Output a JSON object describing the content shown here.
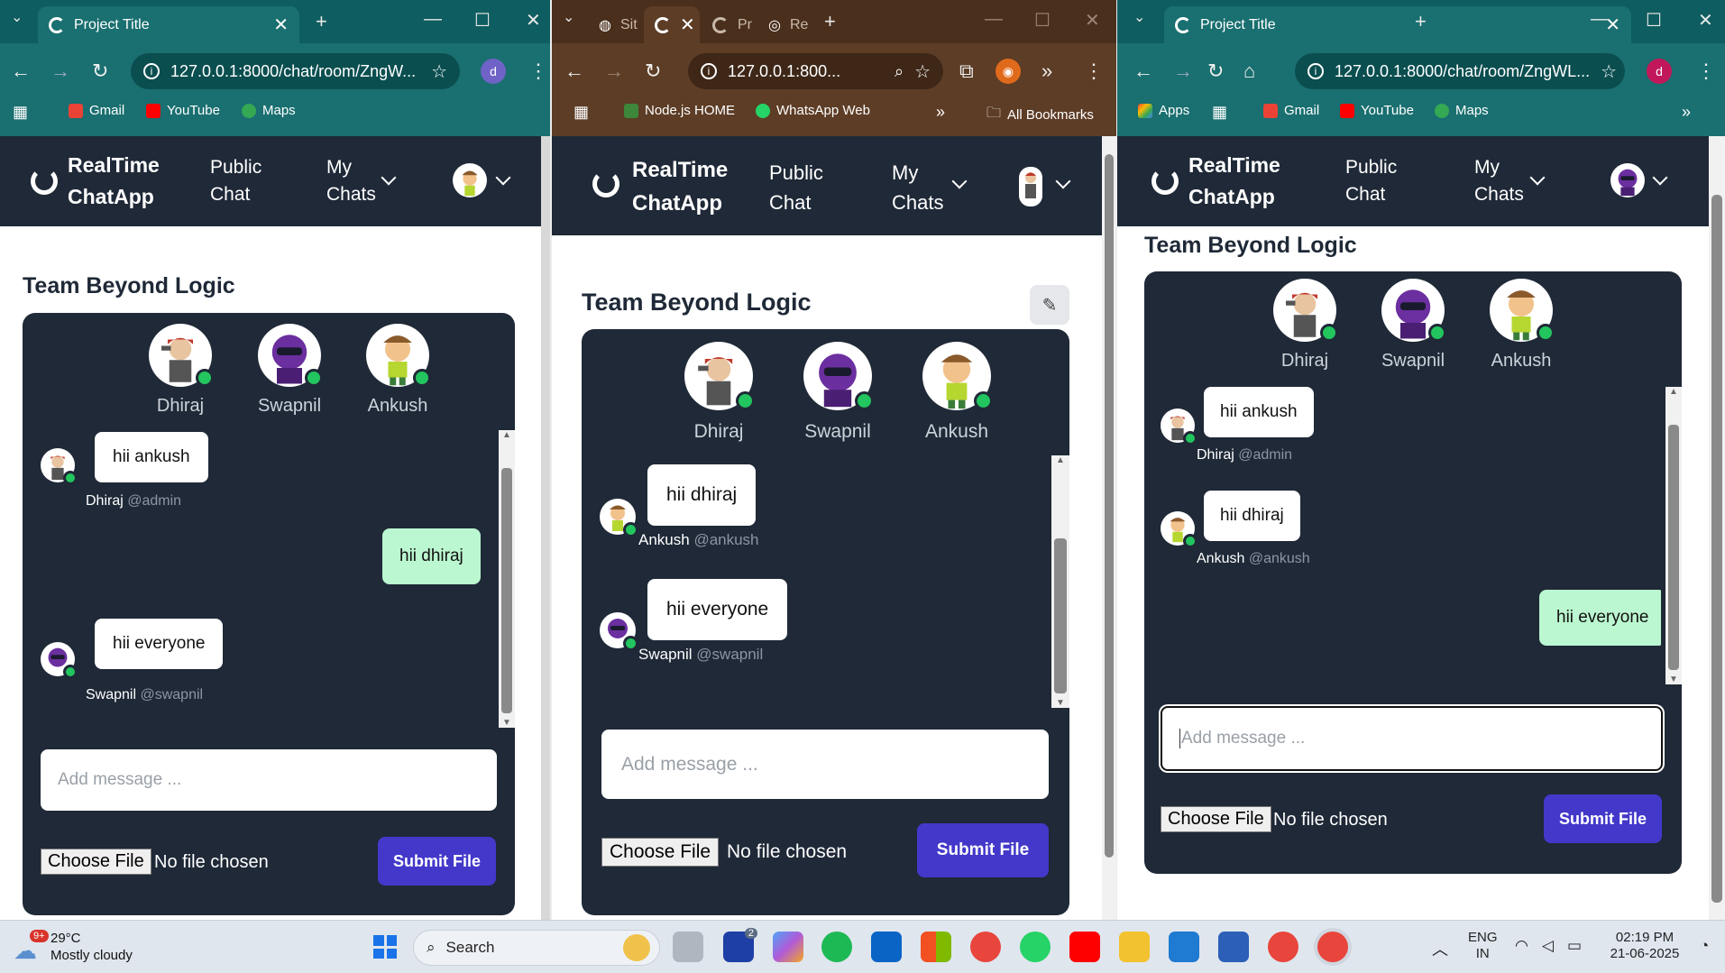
{
  "browser1": {
    "tab_title": "Project Title",
    "address": "127.0.0.1:8000/chat/room/ZngW...",
    "profile_initial": "d",
    "bookmarks": [
      "Gmail",
      "YouTube",
      "Maps"
    ]
  },
  "browser2": {
    "tabs": [
      "Sit",
      "",
      "Pr",
      "Re"
    ],
    "address": "127.0.0.1:800...",
    "bookmarks": [
      "Node.js HOME",
      "WhatsApp Web"
    ],
    "all_bookmarks": "All Bookmarks"
  },
  "browser3": {
    "tab_title": "Project Title",
    "address": "127.0.0.1:8000/chat/room/ZngWL...",
    "profile_initial": "d",
    "bookmarks": [
      "Apps",
      "Gmail",
      "YouTube",
      "Maps"
    ]
  },
  "app": {
    "brand_line1": "RealTime",
    "brand_line2": "ChatApp",
    "nav_public_1": "Public",
    "nav_public_2": "Chat",
    "nav_my_1": "My",
    "nav_my_2": "Chats",
    "room_title": "Team Beyond Logic",
    "members": [
      "Dhiraj",
      "Swapnil",
      "Ankush"
    ],
    "input_placeholder": "Add message ...",
    "choose_file": "Choose File",
    "no_file": "No file chosen",
    "submit_file": "Submit File"
  },
  "chat1": {
    "messages": [
      {
        "text": "hii ankush",
        "author": "Dhiraj",
        "handle": "@admin",
        "mine": false
      },
      {
        "text": "hii dhiraj",
        "author": "",
        "handle": "",
        "mine": true
      },
      {
        "text": "hii everyone",
        "author": "Swapnil",
        "handle": "@swapnil",
        "mine": false
      }
    ]
  },
  "chat2": {
    "messages": [
      {
        "text": "hii dhiraj",
        "author": "Ankush",
        "handle": "@ankush",
        "mine": false
      },
      {
        "text": "hii everyone",
        "author": "Swapnil",
        "handle": "@swapnil",
        "mine": false
      }
    ]
  },
  "chat3": {
    "messages": [
      {
        "text": "hii ankush",
        "author": "Dhiraj",
        "handle": "@admin",
        "mine": false
      },
      {
        "text": "hii dhiraj",
        "author": "Ankush",
        "handle": "@ankush",
        "mine": false
      },
      {
        "text": "hii everyone",
        "author": "",
        "handle": "",
        "mine": true
      }
    ]
  },
  "taskbar": {
    "weather_temp": "29°C",
    "weather_desc": "Mostly cloudy",
    "weather_badge": "9+",
    "search_label": "Search",
    "lang_1": "ENG",
    "lang_2": "IN",
    "time": "02:19 PM",
    "date": "21-06-2025",
    "badge_count": "2"
  },
  "colors": {
    "teal_chrome": "#1a6f70",
    "brown_chrome": "#5d3d26",
    "navbar": "#1f2937",
    "mine_bubble": "#bbf7d0",
    "submit": "#4338ca",
    "online": "#22c55e"
  }
}
